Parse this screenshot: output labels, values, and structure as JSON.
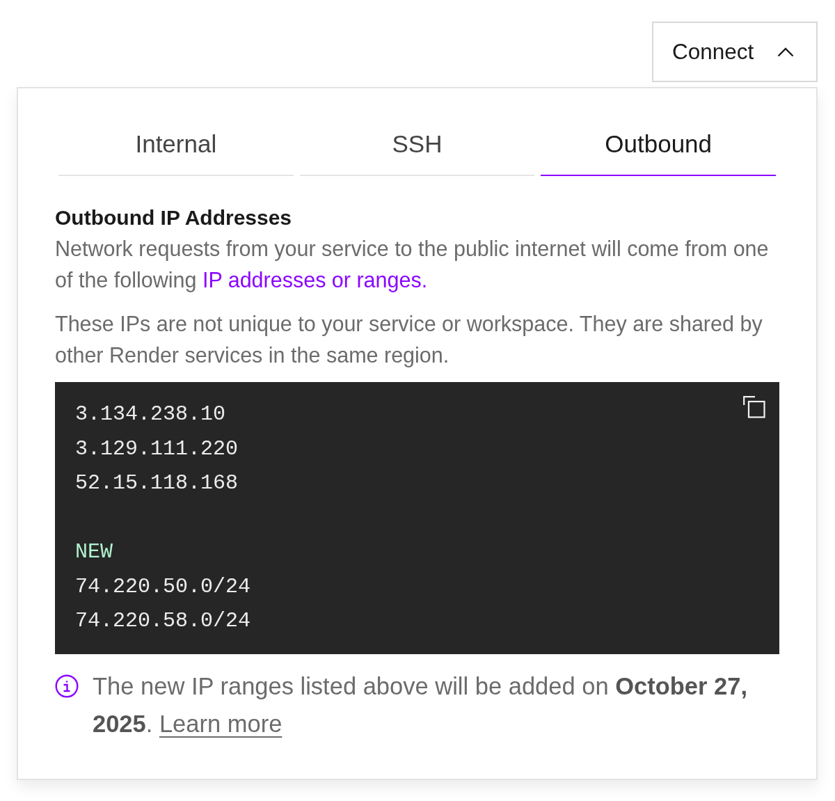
{
  "connect_button": {
    "label": "Connect",
    "expanded": true
  },
  "tabs": [
    {
      "label": "Internal",
      "selected": false
    },
    {
      "label": "SSH",
      "selected": false
    },
    {
      "label": "Outbound",
      "selected": true
    }
  ],
  "section": {
    "title": "Outbound IP Addresses",
    "description": "Network requests from your service to the public internet will come from one of the following ",
    "description_link": "IP addresses or ranges.",
    "note": "These IPs are not unique to your service or workspace. They are shared by other Render services in the same region."
  },
  "code_block": {
    "groups": [
      {
        "lines": [
          "3.134.238.10",
          "3.129.111.220",
          "52.15.118.168"
        ]
      },
      {
        "label": "NEW",
        "lines": [
          "74.220.50.0/24",
          "74.220.58.0/24"
        ]
      }
    ]
  },
  "notice": {
    "text": "The new IP ranges listed above will be added on **October 27, 2025**. ",
    "link": "Learn more"
  }
}
